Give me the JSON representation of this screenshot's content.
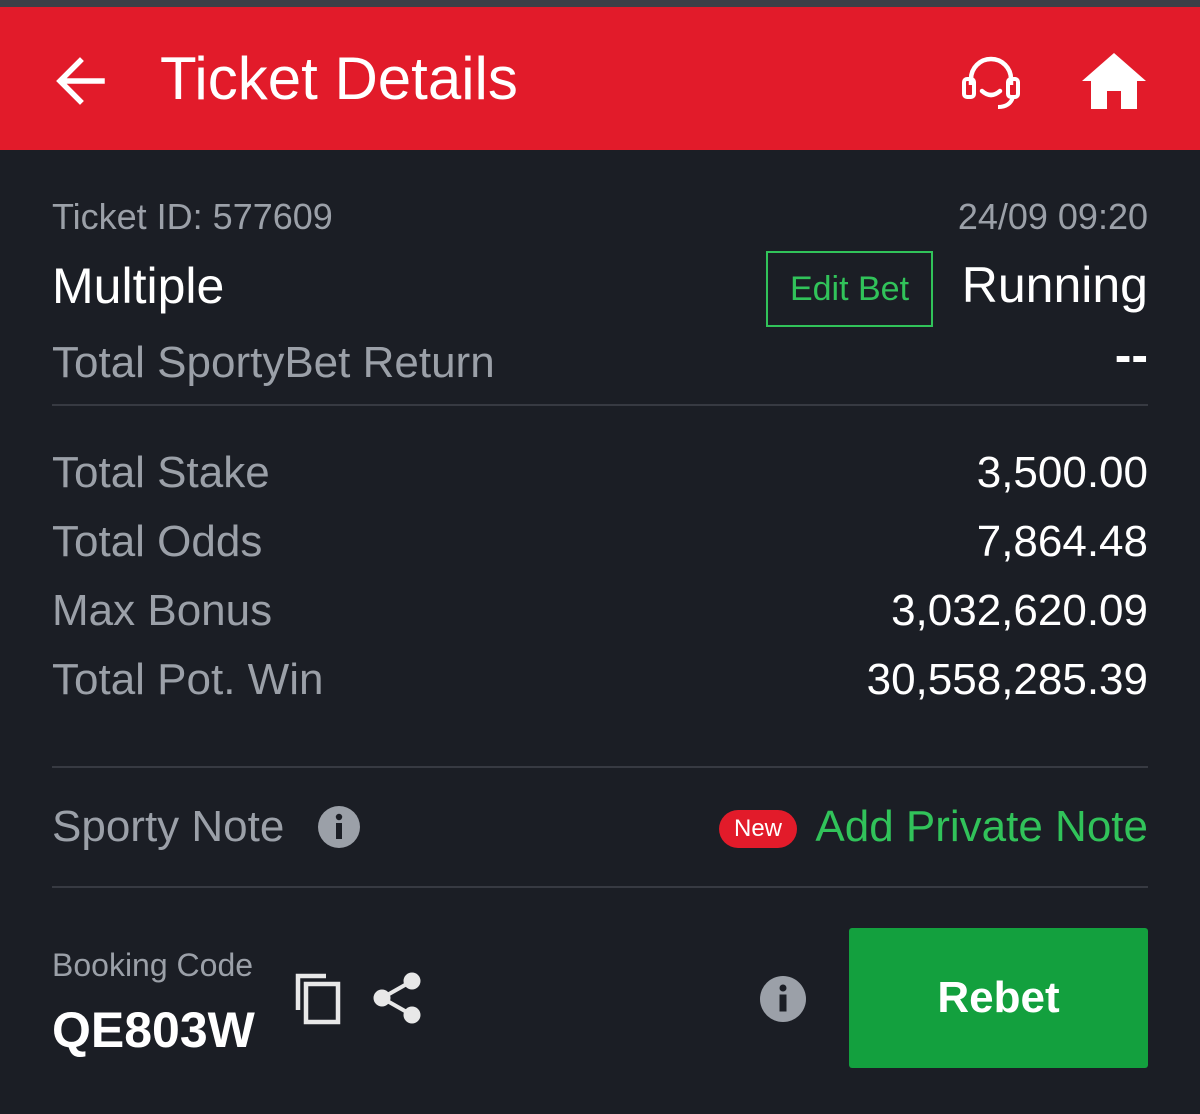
{
  "header": {
    "title": "Ticket Details",
    "back_icon": "arrow-left-icon",
    "support_icon": "headset-icon",
    "home_icon": "home-icon",
    "background_color": "#e21b2a"
  },
  "ticket": {
    "id_label": "Ticket ID: 577609",
    "datetime": "24/09 09:20",
    "bet_type": "Multiple",
    "edit_bet_label": "Edit Bet",
    "status": "Running",
    "return_label": "Total SportyBet Return",
    "return_value": "--"
  },
  "summary": {
    "rows": [
      {
        "label": "Total Stake",
        "value": "3,500.00"
      },
      {
        "label": "Total Odds",
        "value": "7,864.48"
      },
      {
        "label": "Max Bonus",
        "value": "3,032,620.09"
      },
      {
        "label": "Total Pot. Win",
        "value": "30,558,285.39"
      }
    ]
  },
  "note": {
    "label": "Sporty Note",
    "info_icon": "info-icon",
    "new_badge": "New",
    "add_label": "Add Private Note"
  },
  "booking": {
    "label": "Booking Code",
    "code": "QE803W",
    "copy_icon": "copy-icon",
    "share_icon": "share-icon",
    "info_icon": "info-icon",
    "rebet_label": "Rebet"
  },
  "colors": {
    "accent_green": "#31c35a",
    "button_green": "#13a03e",
    "brand_red": "#e21b2a",
    "background": "#1b1e25"
  }
}
